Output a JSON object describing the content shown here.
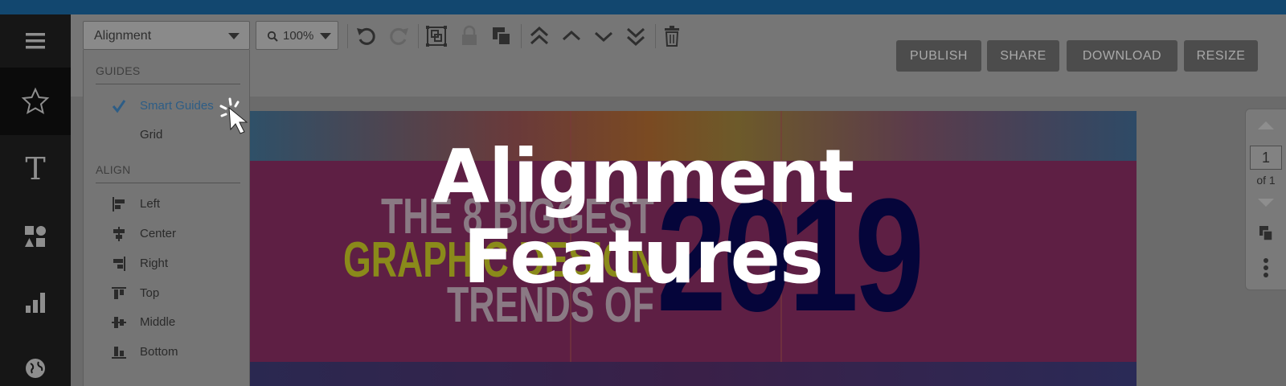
{
  "toolbar": {
    "menu_dropdown_label": "Alignment",
    "zoom_label": "100%",
    "publish_label": "PUBLISH",
    "share_label": "SHARE",
    "download_label": "DOWNLOAD",
    "resize_label": "RESIZE"
  },
  "sidebar": {
    "items": [
      {
        "icon": "hamburger-menu-icon"
      },
      {
        "icon": "star-icon"
      },
      {
        "icon": "text-icon",
        "glyph": "T"
      },
      {
        "icon": "shapes-icon"
      },
      {
        "icon": "bar-chart-icon"
      },
      {
        "icon": "globe-icon"
      }
    ]
  },
  "menu": {
    "guides_heading": "GUIDES",
    "guides": [
      {
        "label": "Smart Guides",
        "checked": true
      },
      {
        "label": "Grid",
        "checked": false
      }
    ],
    "align_heading": "ALIGN",
    "align": [
      {
        "label": "Left",
        "icon": "align-left-icon"
      },
      {
        "label": "Center",
        "icon": "align-center-icon"
      },
      {
        "label": "Right",
        "icon": "align-right-icon"
      },
      {
        "label": "Top",
        "icon": "align-top-icon"
      },
      {
        "label": "Middle",
        "icon": "align-middle-icon"
      },
      {
        "label": "Bottom",
        "icon": "align-bottom-icon"
      }
    ]
  },
  "canvas": {
    "line1": "THE 8 BIGGEST",
    "line2": "GRAPHIC DESIGN",
    "line3": "TRENDS OF",
    "year": "2019"
  },
  "pager": {
    "page": "1",
    "of_label": "of 1"
  },
  "overlay": {
    "title_line1": "Alignment",
    "title_line2": "Features"
  },
  "colors": {
    "topbar": "#12476f",
    "sidebar": "#161616",
    "check_accent": "#2d5d86",
    "overlay_text": "#ffffff"
  }
}
